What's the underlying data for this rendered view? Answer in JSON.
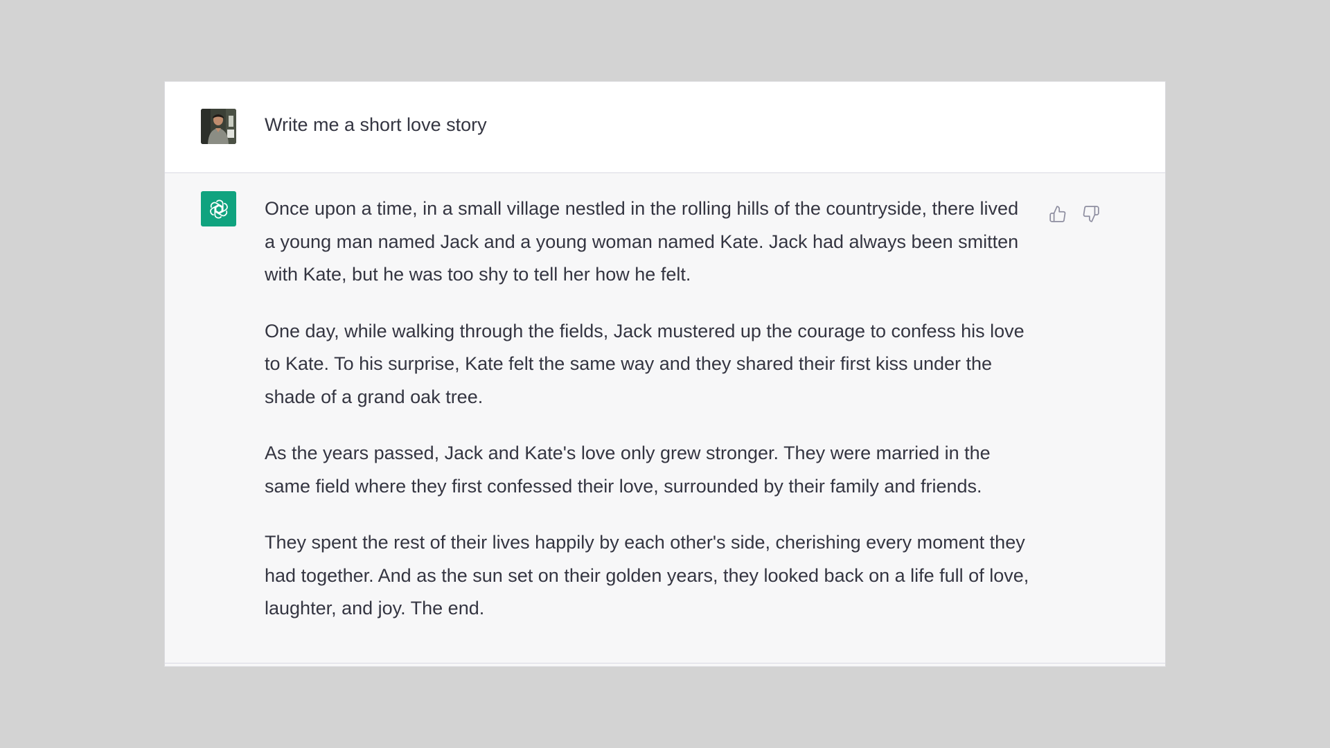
{
  "conversation": {
    "user_message": {
      "avatar": "user-avatar-photo",
      "text": "Write me a short love story"
    },
    "assistant_message": {
      "avatar": "openai-logo-icon",
      "paragraphs": [
        "Once upon a time, in a small village nestled in the rolling hills of the countryside, there lived a young man named Jack and a young woman named Kate. Jack had always been smitten with Kate, but he was too shy to tell her how he felt.",
        "One day, while walking through the fields, Jack mustered up the courage to confess his love to Kate. To his surprise, Kate felt the same way and they shared their first kiss under the shade of a grand oak tree.",
        "As the years passed, Jack and Kate's love only grew stronger. They were married in the same field where they first confessed their love, surrounded by their family and friends.",
        "They spent the rest of their lives happily by each other's side, cherishing every moment they had together. And as the sun set on their golden years, they looked back on a life full of love, laughter, and joy. The end."
      ],
      "feedback": {
        "thumbs_up_icon": "thumbs-up-icon",
        "thumbs_down_icon": "thumbs-down-icon"
      }
    }
  },
  "colors": {
    "page_background": "#d3d3d3",
    "user_row_background": "#ffffff",
    "assistant_row_background": "#f7f7f8",
    "text": "#343541",
    "brand_green": "#10a37f",
    "icon_gray": "#8e8ea0"
  }
}
